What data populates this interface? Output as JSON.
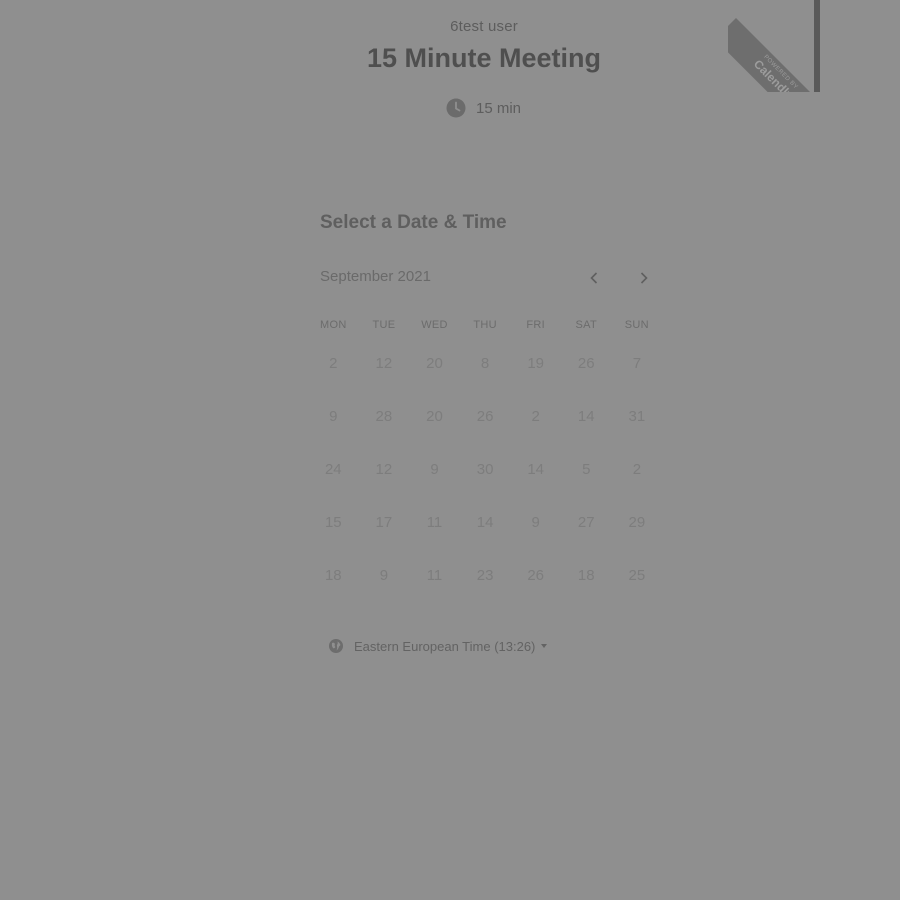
{
  "organizer": {
    "name": "6test user"
  },
  "event": {
    "title": "15 Minute Meeting",
    "duration": "15 min"
  },
  "badge": {
    "powered_by": "POWERED BY",
    "brand": "Calendly"
  },
  "scheduler": {
    "title": "Select a Date & Time",
    "month": "September 2021",
    "prev_icon": "chevron-left-icon",
    "next_icon": "chevron-right-icon",
    "weekdays": [
      "MON",
      "TUE",
      "WED",
      "THU",
      "FRI",
      "SAT",
      "SUN"
    ],
    "days": [
      "2",
      "12",
      "20",
      "8",
      "19",
      "26",
      "7",
      "9",
      "28",
      "20",
      "26",
      "2",
      "14",
      "31",
      "24",
      "12",
      "9",
      "30",
      "14",
      "5",
      "2",
      "15",
      "17",
      "11",
      "14",
      "9",
      "27",
      "29",
      "18",
      "9",
      "11",
      "23",
      "26",
      "18",
      "25"
    ]
  },
  "timezone": {
    "label": "Eastern European Time (13:26)",
    "icon": "globe-icon"
  },
  "colors": {
    "overlay": "#8f8f8f"
  }
}
